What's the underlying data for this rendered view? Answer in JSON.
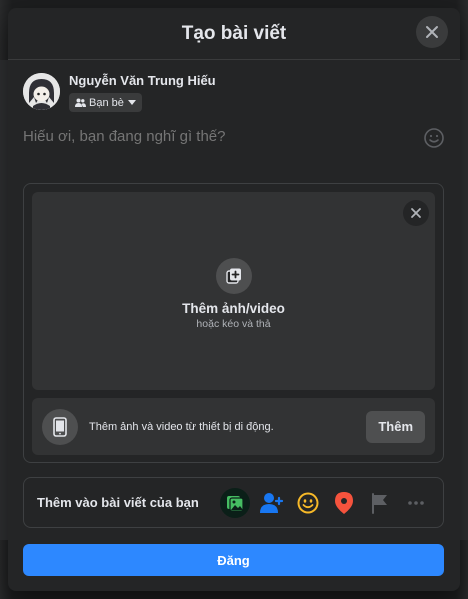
{
  "modal": {
    "title": "Tạo bài viết",
    "close_icon": "close-icon"
  },
  "user": {
    "name": "Nguyễn Văn Trung Hiếu",
    "audience_label": "Bạn bè"
  },
  "composer": {
    "placeholder": "Hiếu ơi, bạn đang nghĩ gì thế?"
  },
  "media": {
    "title": "Thêm ảnh/video",
    "subtitle": "hoặc kéo và thả",
    "mobile_text": "Thêm ảnh và video từ thiết bị di động.",
    "mobile_button": "Thêm"
  },
  "add_to_post": {
    "label": "Thêm vào bài viết của bạn",
    "icons": [
      "photo-video-icon",
      "tag-people-icon",
      "feeling-icon",
      "check-in-icon",
      "flag-icon",
      "more-icon"
    ]
  },
  "post_button": "Đăng",
  "colors": {
    "accent": "#2d88ff",
    "surface": "#242526",
    "card": "#323334"
  }
}
